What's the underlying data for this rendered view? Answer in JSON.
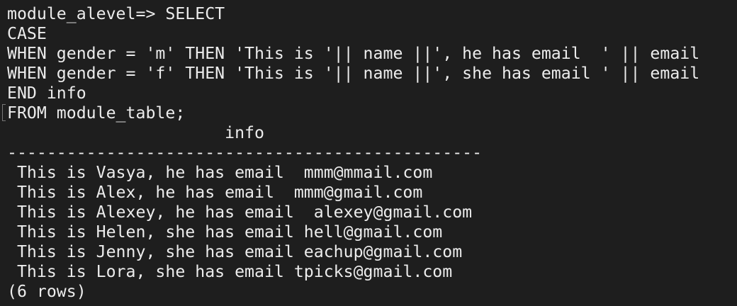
{
  "terminal": {
    "colors": {
      "background": "#1e1e1e",
      "text": "#ececec"
    },
    "query_lines": [
      "module_alevel=> SELECT",
      "CASE",
      "WHEN gender = 'm' THEN 'This is '|| name ||', he has email  ' || email",
      "WHEN gender = 'f' THEN 'This is '|| name ||', she has email ' || email",
      "END info",
      "FROM module_table;"
    ],
    "result": {
      "column_header": "                      info",
      "separator": "------------------------------------------------",
      "rows": [
        " This is Vasya, he has email  mmm@mmail.com",
        " This is Alex, he has email  mmm@gmail.com",
        " This is Alexey, he has email  alexey@gmail.com",
        " This is Helen, she has email hell@gmail.com",
        " This is Jenny, she has email eachup@gmail.com",
        " This is Lora, she has email tpicks@gmail.com"
      ],
      "row_count": "(6 rows)"
    }
  }
}
